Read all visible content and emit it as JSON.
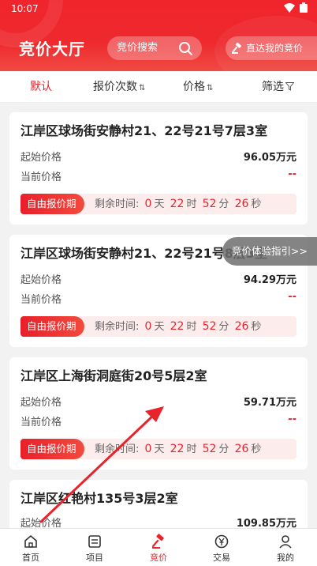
{
  "status_bar": {
    "time": "10:07"
  },
  "header": {
    "title": "竞价大厅",
    "search_placeholder": "竞价搜索",
    "direct_button": "直达我的竞价"
  },
  "sort_bar": {
    "items": [
      {
        "label": "默认"
      },
      {
        "label": "报价次数"
      },
      {
        "label": "价格"
      },
      {
        "label": "筛选"
      }
    ]
  },
  "listings": [
    {
      "address": "江岸区球场街安静村21、22号21号7层3室",
      "start_label": "起始价格",
      "start_price": "96.05万元",
      "current_label": "当前价格",
      "current_price": "--",
      "badge": "自由报价期",
      "remain_label": "剩余时间:",
      "days": "0",
      "hours": "22",
      "minutes": "52",
      "seconds": "26",
      "u_day": "天",
      "u_hour": "时",
      "u_min": "分",
      "u_sec": "秒"
    },
    {
      "address": "江岸区球场街安静村21、22号21号8层3室",
      "start_label": "起始价格",
      "start_price": "94.29万元",
      "current_label": "当前价格",
      "current_price": "--",
      "badge": "自由报价期",
      "remain_label": "剩余时间:",
      "days": "0",
      "hours": "22",
      "minutes": "52",
      "seconds": "26",
      "u_day": "天",
      "u_hour": "时",
      "u_min": "分",
      "u_sec": "秒"
    },
    {
      "address": "江岸区上海街洞庭街20号5层2室",
      "start_label": "起始价格",
      "start_price": "59.71万元",
      "current_label": "当前价格",
      "current_price": "--",
      "badge": "自由报价期",
      "remain_label": "剩余时间:",
      "days": "0",
      "hours": "22",
      "minutes": "52",
      "seconds": "26",
      "u_day": "天",
      "u_hour": "时",
      "u_min": "分",
      "u_sec": "秒"
    },
    {
      "address": "江岸区红艳村135号3层2室",
      "start_label": "起始价格",
      "start_price": "109.85万元"
    }
  ],
  "guide_popup": "竞价体验指引>>",
  "tab_bar": {
    "items": [
      {
        "label": "首页"
      },
      {
        "label": "项目"
      },
      {
        "label": "竞价"
      },
      {
        "label": "交易"
      },
      {
        "label": "我的"
      }
    ]
  },
  "colors": {
    "brand_red": "#e8232b",
    "header_red": "#f0242c"
  }
}
